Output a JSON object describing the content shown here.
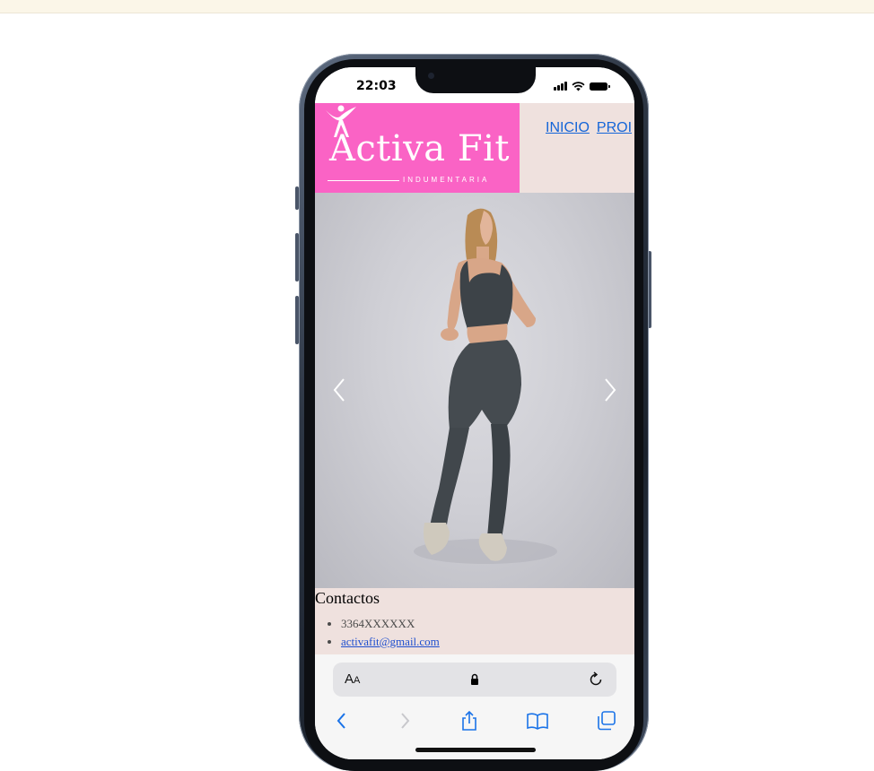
{
  "status_bar": {
    "time": "22:03"
  },
  "site": {
    "logo": {
      "name": "Activa Fit",
      "subtitle": "INDUMENTARIA"
    },
    "nav": [
      {
        "label": "INICIO"
      },
      {
        "label": "PROI"
      }
    ],
    "hero": {
      "prev_icon": "chevron-left-icon",
      "next_icon": "chevron-right-icon"
    },
    "contact": {
      "heading": "Contactos",
      "phone": "3364XXXXXX",
      "email": "activafit@gmail.com"
    }
  },
  "safari": {
    "text_size_label": "A",
    "text_size_label_small": "A",
    "icons": [
      "lock-icon",
      "reload-icon",
      "back-icon",
      "forward-icon",
      "share-icon",
      "bookmarks-icon",
      "tabs-icon"
    ]
  },
  "colors": {
    "logo_bg": "#fa63c5",
    "header_bg": "#efe1de",
    "link": "#1565d8"
  }
}
